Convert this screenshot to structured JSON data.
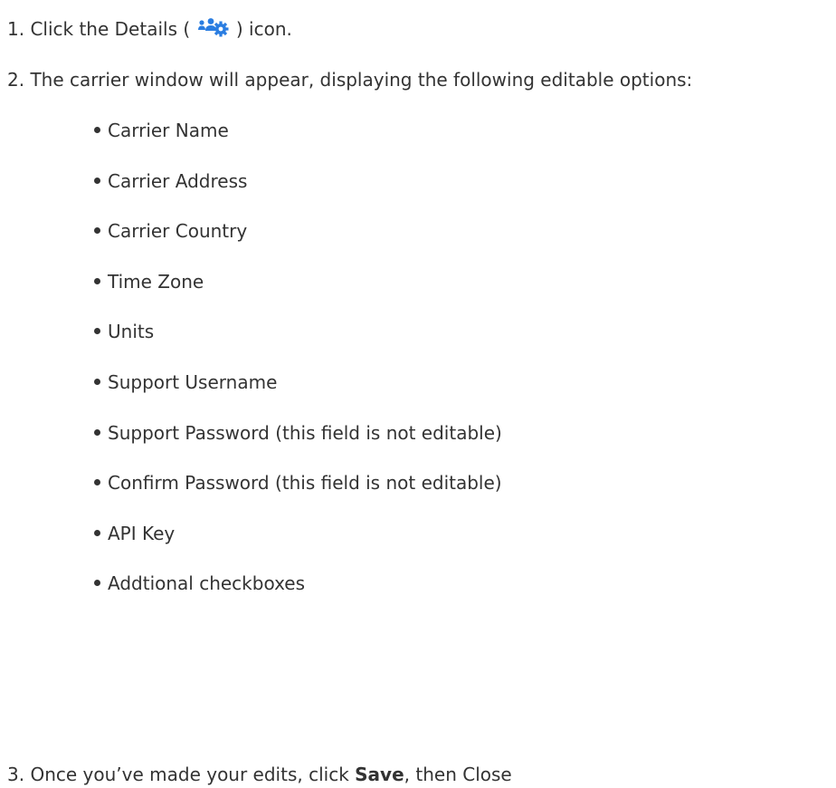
{
  "steps": {
    "step1": {
      "number": "1.",
      "text_before": "Click the Details (",
      "icon": "users-gear-icon",
      "text_after": ") icon."
    },
    "step2": {
      "number": "2.",
      "text": "The carrier window will appear, displaying the following editable options:"
    },
    "step3": {
      "number": "3.",
      "text_before": "Once you’ve made your edits, click",
      "bold": "Save",
      "text_after": ", then Close"
    }
  },
  "options": [
    "Carrier Name",
    "Carrier Address",
    "Carrier Country",
    "Time Zone",
    "Units",
    "Support Username",
    "Support Password (this field is not editable)",
    "Confirm Password (this field is not editable)",
    "API Key",
    "Addtional checkboxes"
  ],
  "colors": {
    "text": "#333333",
    "icon": "#2a7de1"
  }
}
